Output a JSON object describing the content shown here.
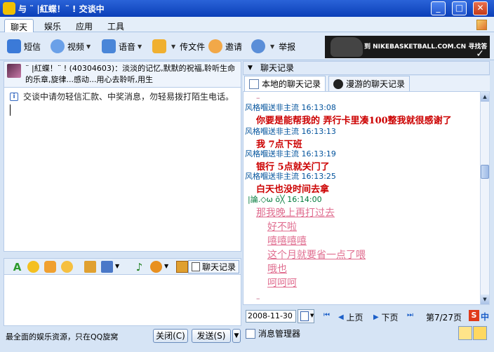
{
  "window": {
    "title": "与 ¨ |紅蝶！¨ ! 交谈中",
    "min_glyph": "_",
    "max_glyph": "□",
    "close_glyph": "✕"
  },
  "menu": {
    "tabs": [
      "聊天",
      "娱乐",
      "应用",
      "工具"
    ],
    "active": "聊天"
  },
  "toolbar": {
    "items": [
      {
        "label": "短信",
        "icon": "sms-icon",
        "color": "#3b7ad8"
      },
      {
        "label": "视频",
        "icon": "video-icon",
        "color": "#6aa0e8"
      },
      {
        "label": "语音",
        "icon": "voice-icon",
        "color": "#4a86d8"
      },
      {
        "label": "传文件",
        "icon": "file-transfer-icon",
        "color": "#f0b030"
      },
      {
        "label": "邀请",
        "icon": "invite-icon",
        "color": "#f2a848"
      },
      {
        "label": "举报",
        "icon": "report-icon",
        "color": "#5a8ed8"
      }
    ],
    "ad_text": "到 NIKEBASKETBALL.COM.CN 寻找答案"
  },
  "contact": {
    "signature": "¨ |紅蝶！¨ ! (40304603)：淡淡的记忆,默默的祝福,聆听生命的乐章,旋律...感动...用心去聆听,用生"
  },
  "notice": "交谈中请勿轻信汇款、中奖消息，勿轻易拨打陌生电话。",
  "fmt_icons": [
    "font-icon",
    "emoji-icon",
    "gift-icon",
    "magic-face-icon",
    "screenshot-icon",
    "scene-icon",
    "music-icon",
    "send-picture-icon",
    "shake-icon"
  ],
  "chatlog_btn": "聊天记录",
  "promo_text": "最全面的娱乐资源，只在QQ旋窝",
  "buttons": {
    "close": "关闭(C)",
    "send": "发送(S)"
  },
  "history": {
    "header": "聊天记录",
    "tabs": [
      "本地的聊天记录",
      "漫游的聊天记录"
    ],
    "active_tab": "本地的聊天记录",
    "messages": [
      {
        "sender": "风格嗰送非主流",
        "time": "16:13:08",
        "text": "你要是能帮我的  弄行卡里凑100整我就很感谢了"
      },
      {
        "sender": "风格嗰送非主流",
        "time": "16:13:13",
        "text": "我  7点下班"
      },
      {
        "sender": "风格嗰送非主流",
        "time": "16:13:19",
        "text": "银行  5点就关门了"
      },
      {
        "sender": "风格嗰送非主流",
        "time": "16:13:25",
        "text": "白天也没时间去拿"
      }
    ],
    "other": {
      "sender": "|論.◇ω ŏ╳",
      "time": "16:14:00",
      "lines": [
        "那我晚上再打过去",
        "好不啦",
        "嘻嘻嘻嘻",
        "这个月就要省一点了喂",
        "哦也",
        "呵呵呵"
      ]
    }
  },
  "date_value": "2008-11-30",
  "nav": {
    "prev": "上页",
    "next": "下页",
    "page_info": "第7/27页",
    "s_badge": "S",
    "zh_label": "中"
  },
  "manager": "消息管理器"
}
